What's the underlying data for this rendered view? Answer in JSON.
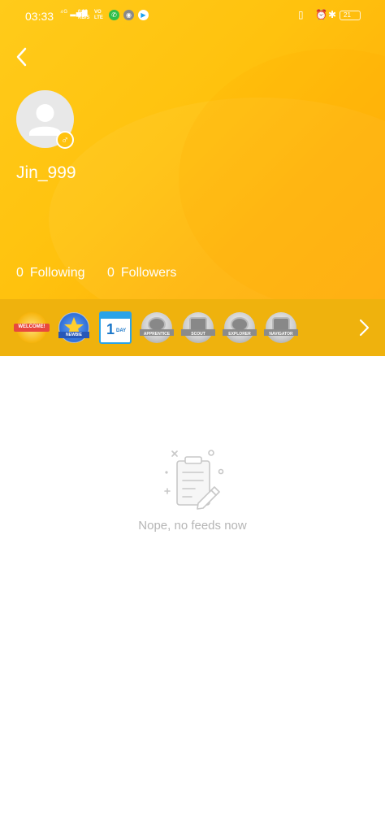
{
  "status_bar": {
    "time": "03:33",
    "signal": "⁴ᴳ ▂▄▆",
    "network_speed_top": "0.00",
    "network_speed_bottom": "KB/S",
    "volte_top": "VO",
    "volte_bottom": "LTE",
    "battery": "21"
  },
  "profile": {
    "username": "Jin_999",
    "gender_symbol": "♂",
    "following_count": "0",
    "following_label": "Following",
    "followers_count": "0",
    "followers_label": "Followers"
  },
  "badges": [
    {
      "name": "WELCOME!",
      "icon": "welcome-badge-icon"
    },
    {
      "name": "NEWBIE",
      "icon": "newbie-badge-icon"
    },
    {
      "name": "1",
      "sub": "DAY",
      "icon": "one-day-badge-icon"
    },
    {
      "name": "APPRENTICE",
      "icon": "apprentice-badge-icon"
    },
    {
      "name": "SCOUT",
      "icon": "scout-badge-icon"
    },
    {
      "name": "EXPLORER",
      "icon": "explorer-badge-icon"
    },
    {
      "name": "NAVIGATOR",
      "icon": "navigator-badge-icon"
    }
  ],
  "feed": {
    "empty_message": "Nope, no feeds now"
  },
  "colors": {
    "header_yellow": "#ffc20e",
    "badge_bar": "#efb20d",
    "empty_text": "#b5b5b5"
  }
}
